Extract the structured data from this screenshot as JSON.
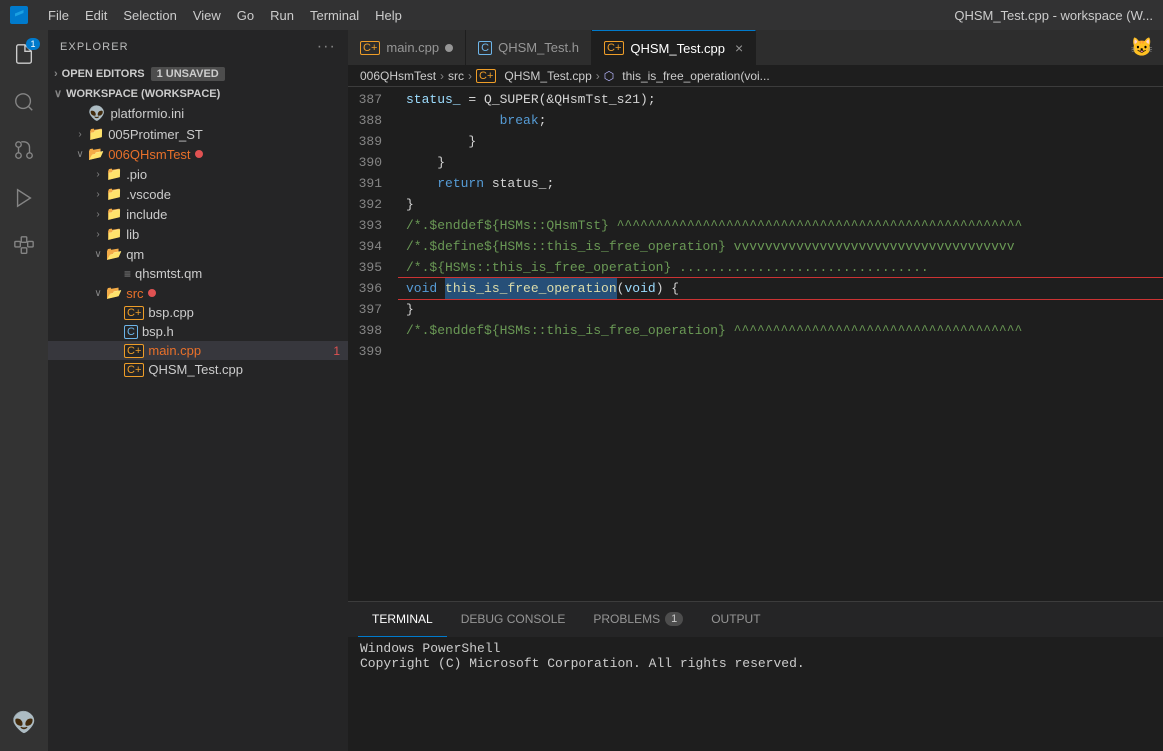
{
  "titleBar": {
    "logo": "VS",
    "menus": [
      "File",
      "Edit",
      "Selection",
      "View",
      "Go",
      "Run",
      "Terminal",
      "Help"
    ],
    "title": "QHSM_Test.cpp - workspace (W..."
  },
  "activityBar": {
    "icons": [
      {
        "name": "explorer-icon",
        "symbol": "⎘",
        "active": false,
        "badge": "1"
      },
      {
        "name": "search-icon",
        "symbol": "🔍",
        "active": false
      },
      {
        "name": "source-control-icon",
        "symbol": "⑂",
        "active": false
      },
      {
        "name": "run-icon",
        "symbol": "▷",
        "active": false
      },
      {
        "name": "extensions-icon",
        "symbol": "⊞",
        "active": false
      },
      {
        "name": "platformio-icon",
        "symbol": "👽",
        "active": false
      }
    ]
  },
  "sidebar": {
    "title": "EXPLORER",
    "sections": {
      "openEditors": {
        "label": "OPEN EDITORS",
        "badge": "1 UNSAVED"
      },
      "workspace": {
        "label": "WORKSPACE (WORKSPACE)",
        "items": [
          {
            "id": "platformio-ini",
            "label": "platformio.ini",
            "indent": 1,
            "icon": "👽",
            "type": "file"
          },
          {
            "id": "005protimer",
            "label": "005Protimer_ST",
            "indent": 1,
            "icon": "",
            "type": "folder-collapsed"
          },
          {
            "id": "006qhsmtest",
            "label": "006QHsmTest",
            "indent": 1,
            "icon": "",
            "type": "folder-expanded",
            "modified": true
          },
          {
            "id": "pio",
            "label": ".pio",
            "indent": 2,
            "icon": "",
            "type": "folder-collapsed"
          },
          {
            "id": "vscode",
            "label": ".vscode",
            "indent": 2,
            "icon": "",
            "type": "folder-collapsed"
          },
          {
            "id": "include",
            "label": "include",
            "indent": 2,
            "icon": "",
            "type": "folder-collapsed"
          },
          {
            "id": "lib",
            "label": "lib",
            "indent": 2,
            "icon": "",
            "type": "folder-collapsed"
          },
          {
            "id": "qm",
            "label": "qm",
            "indent": 2,
            "icon": "",
            "type": "folder-expanded"
          },
          {
            "id": "qhsmtst-qm",
            "label": "qhsmtst.qm",
            "indent": 3,
            "icon": "≡",
            "type": "file"
          },
          {
            "id": "src",
            "label": "src",
            "indent": 2,
            "icon": "",
            "type": "folder-expanded",
            "modified": true
          },
          {
            "id": "bsp-cpp",
            "label": "bsp.cpp",
            "indent": 3,
            "icon": "C+",
            "type": "file"
          },
          {
            "id": "bsp-h",
            "label": "bsp.h",
            "indent": 3,
            "icon": "C",
            "type": "file"
          },
          {
            "id": "main-cpp",
            "label": "main.cpp",
            "indent": 3,
            "icon": "C+",
            "type": "file",
            "badge": "1",
            "active": true
          },
          {
            "id": "qhsm-test-cpp",
            "label": "QHSM_Test.cpp",
            "indent": 3,
            "icon": "C+",
            "type": "file"
          }
        ]
      }
    }
  },
  "tabs": [
    {
      "id": "main-cpp-tab",
      "label": "main.cpp",
      "icon": "C+",
      "iconColor": "#ee9d28",
      "active": false,
      "modified": true
    },
    {
      "id": "qhsm-test-h-tab",
      "label": "QHSM_Test.h",
      "icon": "C",
      "iconColor": "#6db5e9",
      "active": false
    },
    {
      "id": "qhsm-test-cpp-tab",
      "label": "QHSM_Test.cpp",
      "icon": "C+",
      "iconColor": "#ee9d28",
      "active": true,
      "closeable": true
    }
  ],
  "breadcrumb": {
    "parts": [
      "006QHsmTest",
      "src",
      "QHSM_Test.cpp",
      "this_is_free_operation(voi..."
    ]
  },
  "codeLines": [
    {
      "num": 387,
      "content": "            status_ = Q_SUPER(&QHsmTst_s21);",
      "tokens": [
        {
          "text": "            status_ = Q_SUPER(&QHsmTst_s21);",
          "class": ""
        }
      ]
    },
    {
      "num": 388,
      "content": "            break;",
      "tokens": [
        {
          "text": "            ",
          "class": ""
        },
        {
          "text": "break",
          "class": "kw"
        },
        {
          "text": ";",
          "class": ""
        }
      ]
    },
    {
      "num": 389,
      "content": "        }",
      "tokens": [
        {
          "text": "        }",
          "class": ""
        }
      ]
    },
    {
      "num": 390,
      "content": "    }",
      "tokens": [
        {
          "text": "    }",
          "class": ""
        }
      ]
    },
    {
      "num": 391,
      "content": "    return status_;",
      "tokens": [
        {
          "text": "    ",
          "class": ""
        },
        {
          "text": "return",
          "class": "kw"
        },
        {
          "text": " status_;",
          "class": ""
        }
      ]
    },
    {
      "num": 392,
      "content": "}",
      "tokens": [
        {
          "text": "}",
          "class": ""
        }
      ]
    },
    {
      "num": 393,
      "content": "/*.$enddef${HSMs::QHsmTst} ^^^^^^^^^^^^^^^^^^^^^^^^^^^^",
      "tokens": [
        {
          "text": "/*.$enddef${HSMs::QHsmTst} ^^^^^^^^^^^^^^^^^^^^^^^^^^^^",
          "class": "comment"
        }
      ]
    },
    {
      "num": 394,
      "content": "/*.$define${HSMs::this_is_free_operation} vvvvvvvvvvvvv",
      "tokens": [
        {
          "text": "/*.$define${HSMs::this_is_free_operation} vvvvvvvvvvvvv",
          "class": "comment"
        }
      ]
    },
    {
      "num": 395,
      "content": "/*.${HSMs::this_is_free_operation} ...............",
      "tokens": [
        {
          "text": "/*.${HSMs::this_is_free_operation} ...............",
          "class": "comment"
        }
      ]
    },
    {
      "num": 396,
      "content": "void this_is_free_operation(void) {",
      "highlighted": true,
      "tokens": [
        {
          "text": "void",
          "class": "kw"
        },
        {
          "text": " ",
          "class": ""
        },
        {
          "text": "this_is_free_operation",
          "class": "fn selected-text"
        },
        {
          "text": "(",
          "class": ""
        },
        {
          "text": "void",
          "class": "param"
        },
        {
          "text": ") {",
          "class": ""
        }
      ]
    },
    {
      "num": 397,
      "content": "}",
      "tokens": [
        {
          "text": "}",
          "class": ""
        }
      ]
    },
    {
      "num": 398,
      "content": "/*.$enddef${HSMs::this_is_free_operation} ^^^^^",
      "tokens": [
        {
          "text": "/*.$enddef${HSMs::this_is_free_operation} ^^^^^",
          "class": "comment"
        }
      ]
    },
    {
      "num": 399,
      "content": "",
      "tokens": [
        {
          "text": "",
          "class": ""
        }
      ]
    }
  ],
  "terminalPanel": {
    "tabs": [
      {
        "id": "terminal-tab",
        "label": "TERMINAL",
        "active": true
      },
      {
        "id": "debug-console-tab",
        "label": "DEBUG CONSOLE",
        "active": false
      },
      {
        "id": "problems-tab",
        "label": "PROBLEMS",
        "active": false,
        "badge": "1"
      },
      {
        "id": "output-tab",
        "label": "OUTPUT",
        "active": false
      }
    ],
    "content": [
      "Windows PowerShell",
      "Copyright (C) Microsoft Corporation. All rights reserved."
    ]
  }
}
